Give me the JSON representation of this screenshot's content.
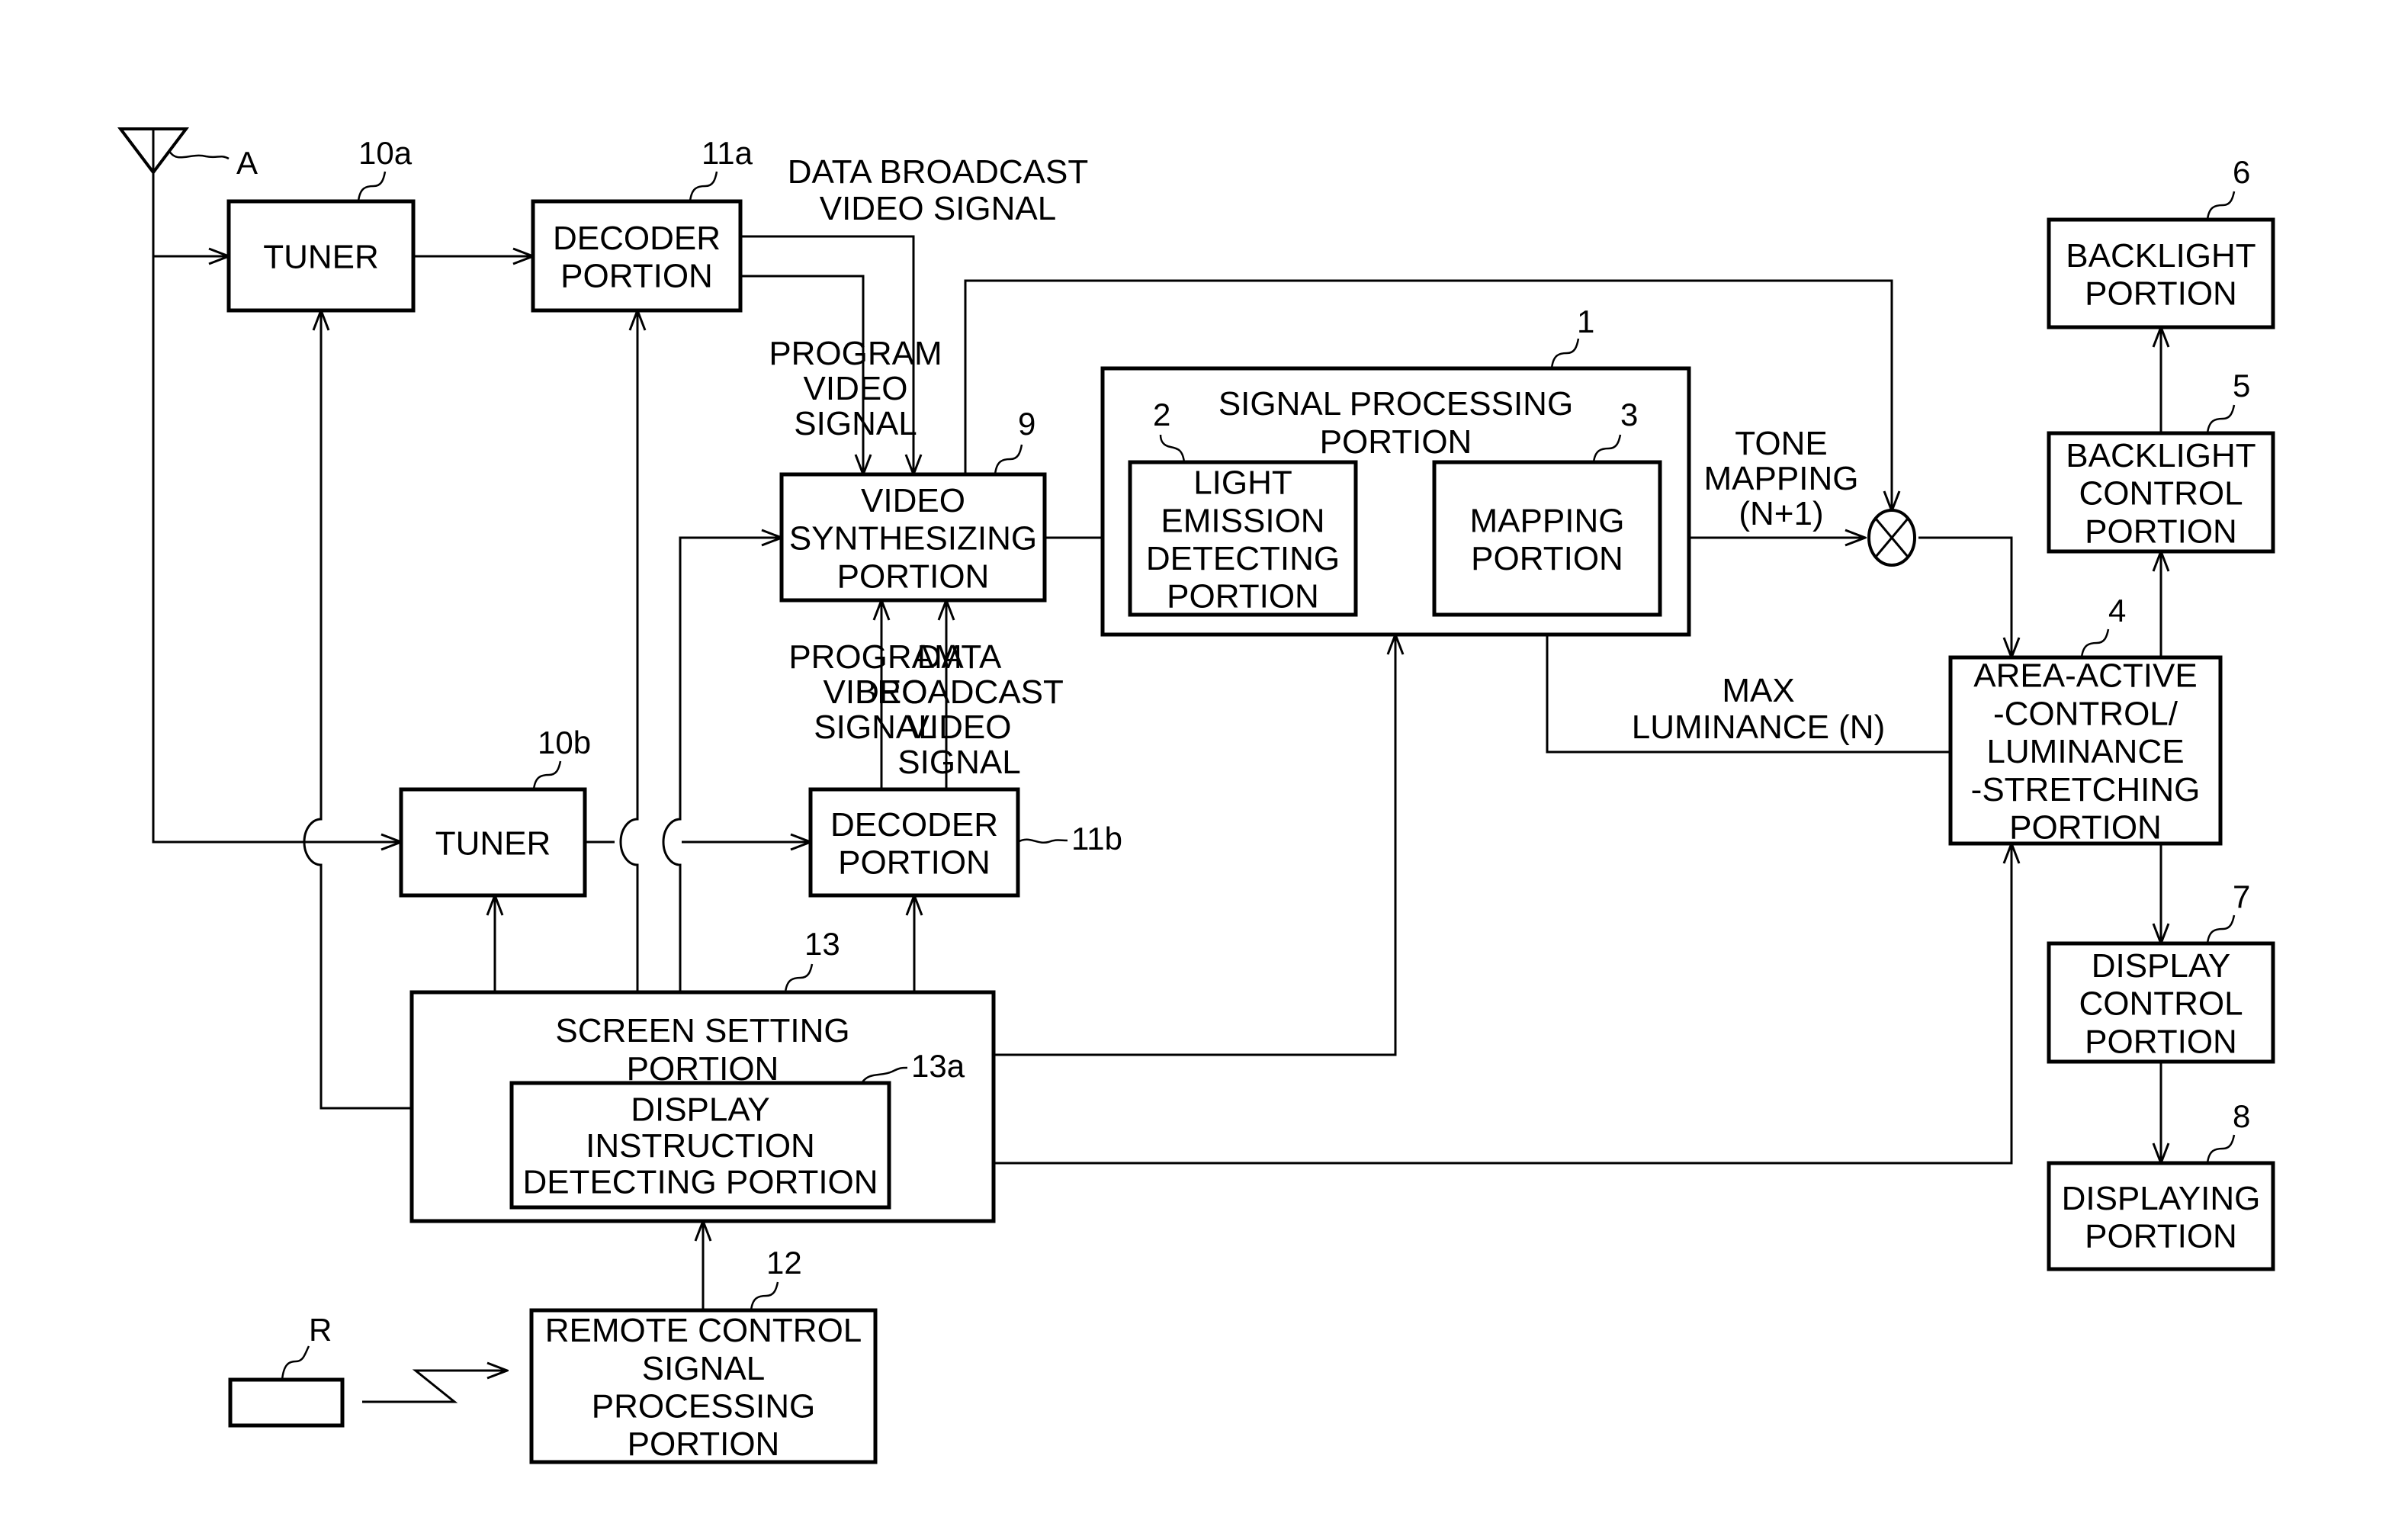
{
  "figure": {
    "type": "block-diagram",
    "description": "Television receiver signal processing block diagram"
  },
  "antenna": {
    "ref": "A"
  },
  "remote": {
    "ref": "R"
  },
  "blocks": {
    "tuner_a": {
      "ref": "10a",
      "lines": [
        "TUNER"
      ]
    },
    "decoder_a": {
      "ref": "11a",
      "lines": [
        "DECODER",
        "PORTION"
      ]
    },
    "video_synth": {
      "ref": "9",
      "lines": [
        "VIDEO",
        "SYNTHESIZING",
        "PORTION"
      ]
    },
    "signal_proc": {
      "ref": "1",
      "lines": [
        "SIGNAL PROCESSING",
        "PORTION"
      ]
    },
    "light_emission": {
      "ref": "2",
      "lines": [
        "LIGHT",
        "EMISSION",
        "DETECTING",
        "PORTION"
      ]
    },
    "mapping": {
      "ref": "3",
      "lines": [
        "MAPPING",
        "PORTION"
      ]
    },
    "area_active": {
      "ref": "4",
      "lines": [
        "AREA-ACTIVE",
        "-CONTROL/",
        "LUMINANCE",
        "-STRETCHING",
        "PORTION"
      ]
    },
    "backlight_ctrl": {
      "ref": "5",
      "lines": [
        "BACKLIGHT",
        "CONTROL",
        "PORTION"
      ]
    },
    "backlight": {
      "ref": "6",
      "lines": [
        "BACKLIGHT",
        "PORTION"
      ]
    },
    "display_ctrl": {
      "ref": "7",
      "lines": [
        "DISPLAY",
        "CONTROL",
        "PORTION"
      ]
    },
    "displaying": {
      "ref": "8",
      "lines": [
        "DISPLAYING",
        "PORTION"
      ]
    },
    "tuner_b": {
      "ref": "10b",
      "lines": [
        "TUNER"
      ]
    },
    "decoder_b": {
      "ref": "11b",
      "lines": [
        "DECODER",
        "PORTION"
      ]
    },
    "screen_setting": {
      "ref": "13",
      "lines": [
        "SCREEN SETTING",
        "PORTION"
      ]
    },
    "display_instr": {
      "ref": "13a",
      "lines": [
        "DISPLAY",
        "INSTRUCTION",
        "DETECTING PORTION"
      ]
    },
    "remote_proc": {
      "ref": "12",
      "lines": [
        "REMOTE CONTROL",
        "SIGNAL",
        "PROCESSING",
        "PORTION"
      ]
    }
  },
  "signal_labels": {
    "data_broadcast_a": [
      "DATA BROADCAST",
      "VIDEO SIGNAL"
    ],
    "program_video_a": [
      "PROGRAM",
      "VIDEO",
      "SIGNAL"
    ],
    "program_video_b": [
      "PROGRAM",
      "VIDEO",
      "SIGNAL"
    ],
    "data_broadcast_b": [
      "DATA",
      "BROADCAST",
      "VIDEO",
      "SIGNAL"
    ],
    "tone_mapping": [
      "TONE",
      "MAPPING",
      "(N+1)"
    ],
    "max_luminance": [
      "MAX",
      "LUMINANCE (N)"
    ]
  }
}
